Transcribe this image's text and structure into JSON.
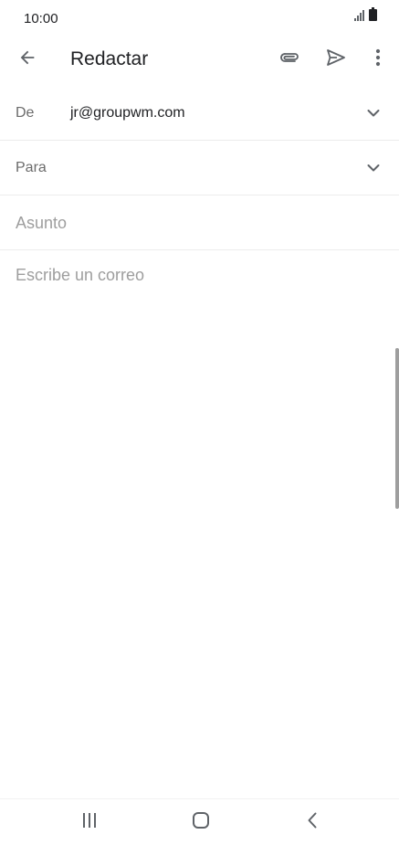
{
  "status_bar": {
    "time": "10:00",
    "icons": [
      "signal-icon",
      "battery-icon"
    ]
  },
  "app_bar": {
    "title": "Redactar",
    "icons": {
      "back": "arrow-left-icon",
      "attach": "paperclip-icon",
      "send": "send-icon",
      "more": "more-vertical-icon"
    }
  },
  "compose": {
    "from": {
      "label": "De",
      "value": "jr@groupwm.com"
    },
    "to": {
      "label": "Para"
    },
    "subject": {
      "placeholder": "Asunto"
    },
    "body": {
      "placeholder": "Escribe un correo"
    }
  },
  "nav_bar": {
    "icons": [
      "recents-icon",
      "home-icon",
      "back-icon"
    ]
  },
  "colors": {
    "icon": "#5f6368",
    "text": "#202124",
    "placeholder": "#9e9e9e",
    "divider": "#ececec"
  }
}
